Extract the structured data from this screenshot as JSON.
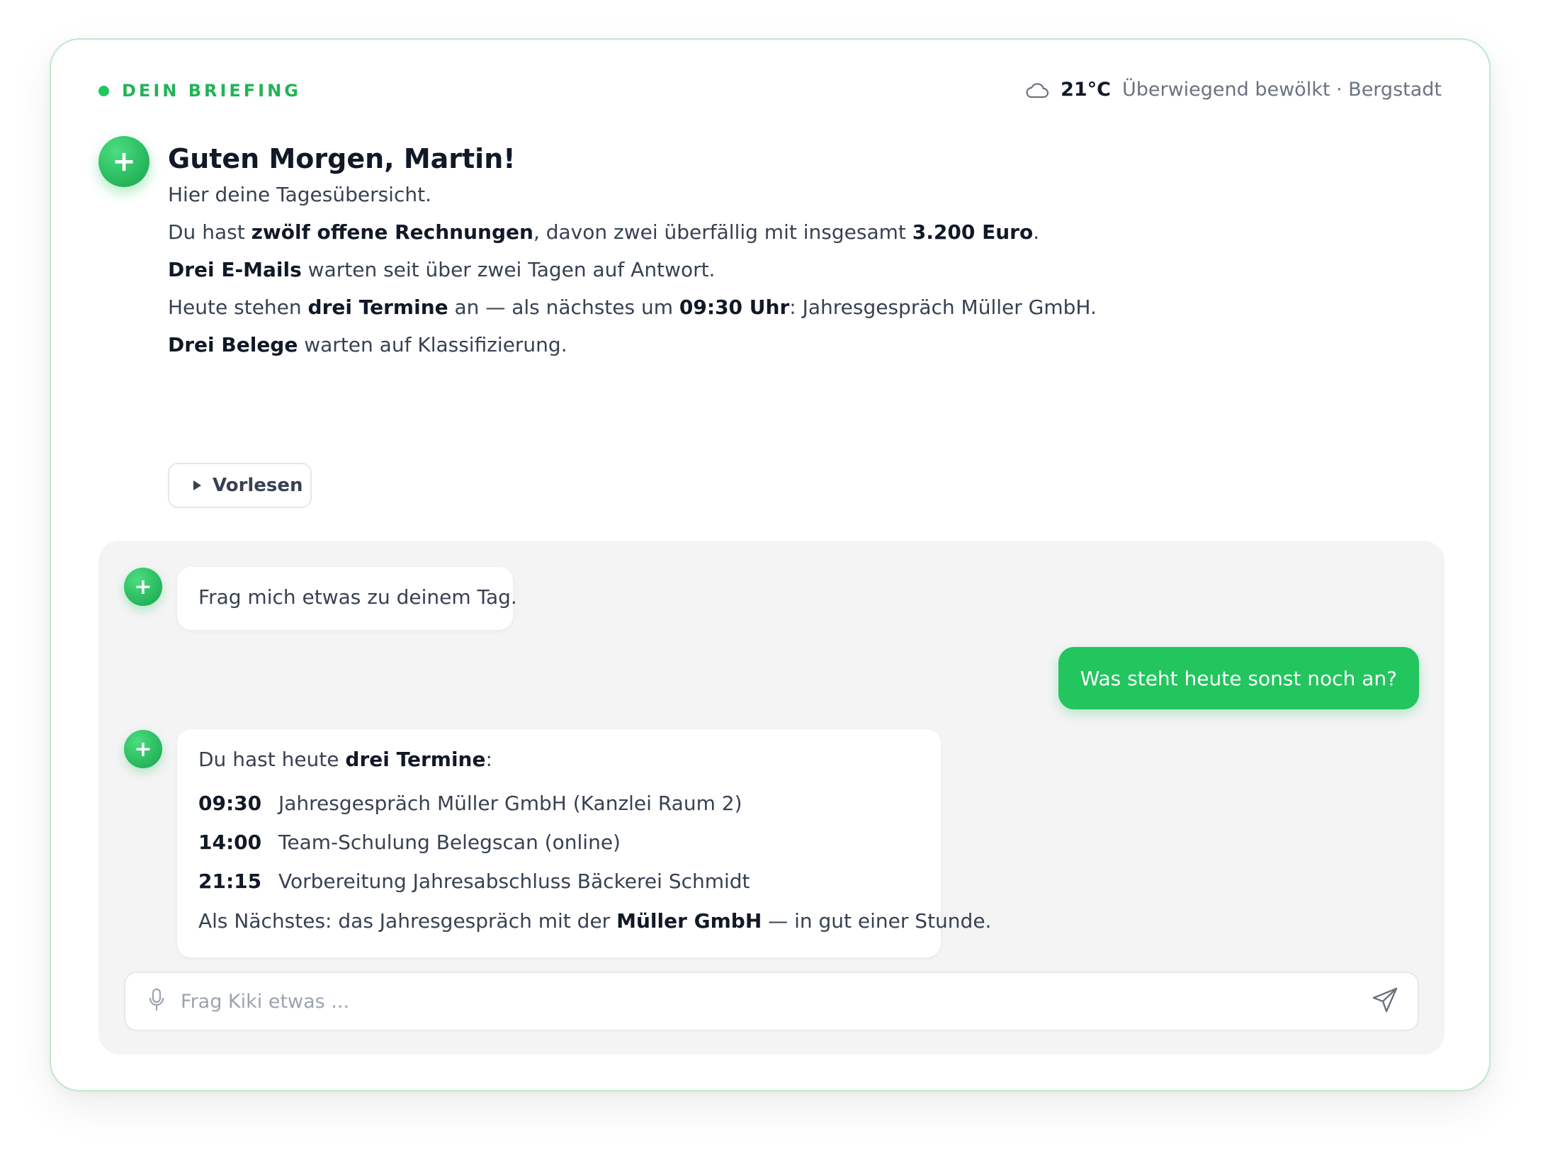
{
  "header": {
    "label": "DEIN BRIEFING",
    "weather_icon": "cloud-icon",
    "temperature": "21°C",
    "weather_text": "Überwiegend bewölkt · Bergstadt"
  },
  "greeting": {
    "title": "Guten Morgen, Martin!",
    "intro": "Hier deine Tagesübersicht.",
    "invoices": {
      "pre": "Du hast ",
      "bold1": "zwölf offene Rechnungen",
      "mid": ", davon zwei überfällig mit insgesamt ",
      "bold2": "3.200 Euro",
      "post": "."
    },
    "emails": {
      "bold": "Drei E-Mails",
      "post": " warten seit über zwei Tagen auf Antwort."
    },
    "appointments": {
      "pre": "Heute stehen ",
      "bold1": "drei Termine",
      "mid": " an — als nächstes um ",
      "bold2": "09:30 Uhr",
      "post": ": Jahresgespräch Müller GmbH."
    },
    "receipts": {
      "bold": "Drei Belege",
      "post": " warten auf Klassifizierung."
    },
    "read_button": "Vorlesen"
  },
  "chat": {
    "assistant_icon": "plus-icon",
    "assistant_message_1": "Frag mich etwas zu deinem Tag.",
    "user_message": "Was steht heute sonst noch an?",
    "assistant_message_2": {
      "intro_pre": "Du hast heute ",
      "intro_bold": "drei Termine",
      "intro_post": ":",
      "appointments": [
        {
          "time": "09:30",
          "text": "Jahresgespräch Müller GmbH (Kanzlei Raum 2)"
        },
        {
          "time": "14:00",
          "text": "Team-Schulung Belegscan (online)"
        },
        {
          "time": "21:15",
          "text": "Vorbereitung Jahresabschluss Bäckerei Schmidt"
        }
      ],
      "outro_pre": "Als Nächstes: das Jahresgespräch mit der ",
      "outro_bold": "Müller GmbH",
      "outro_post": " — in gut einer Stunde."
    },
    "input": {
      "placeholder": "Frag Kiki etwas ...",
      "value": ""
    }
  },
  "colors": {
    "accent": "#22c55e",
    "accent_dark": "#16a34a",
    "panel_bg": "#f4f4f5",
    "card_border": "#bfe8cc"
  }
}
